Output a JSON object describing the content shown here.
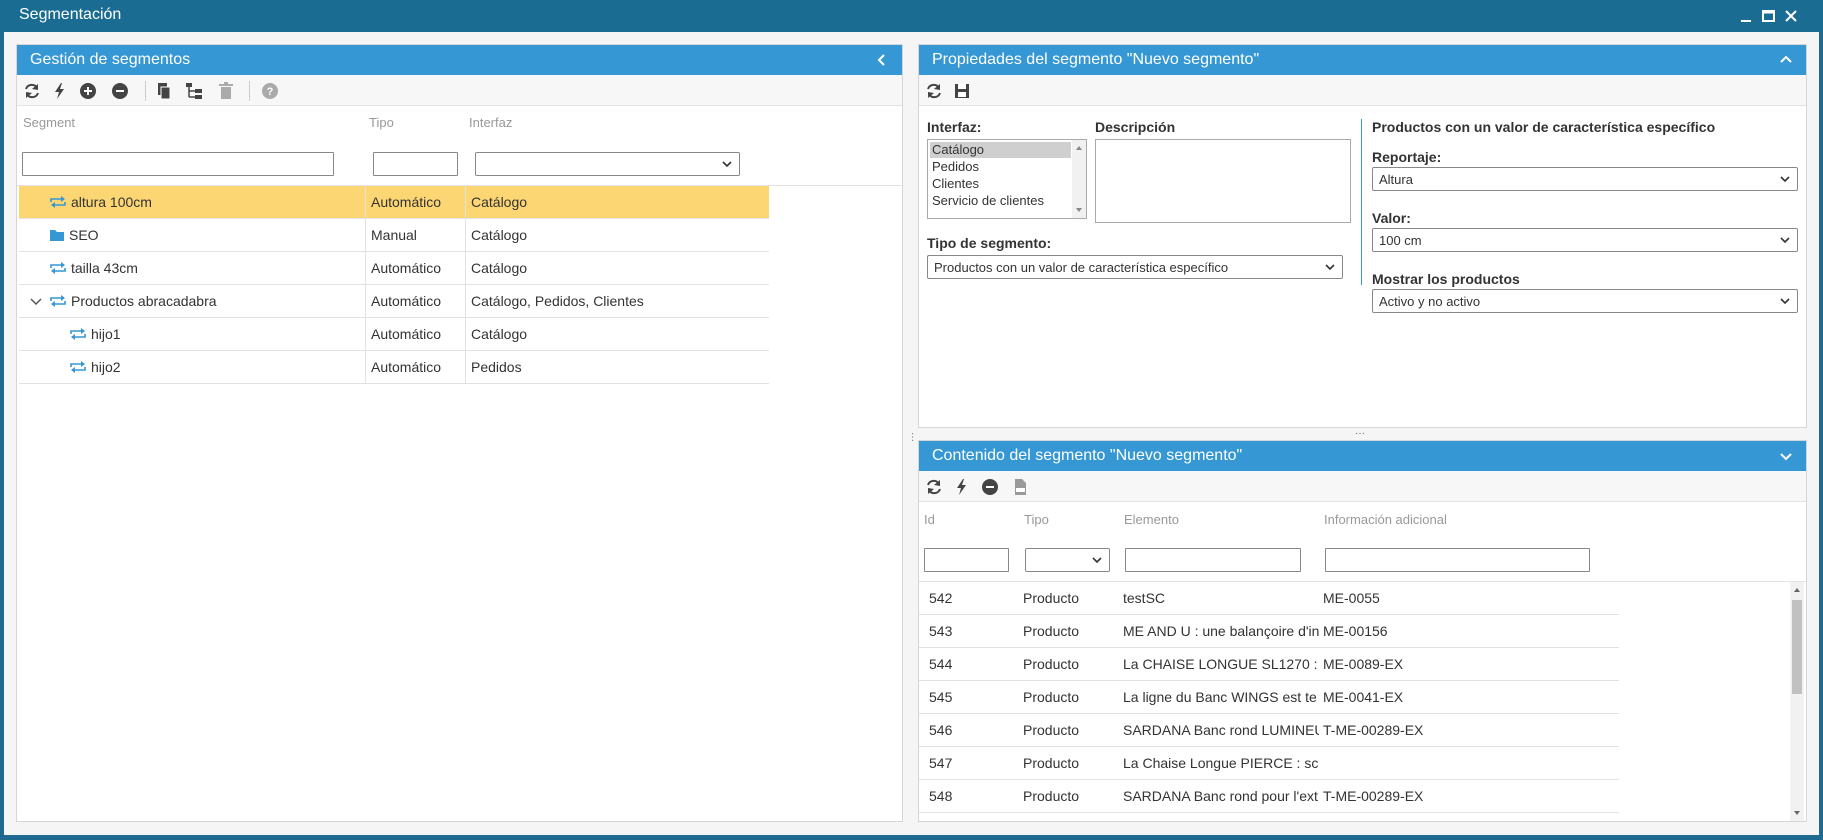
{
  "window": {
    "title": "Segmentación"
  },
  "left_panel": {
    "title": "Gestión de segmentos",
    "columns": {
      "segment": "Segment",
      "tipo": "Tipo",
      "interfaz": "Interfaz"
    },
    "rows": [
      {
        "name": "altura 100cm",
        "icon": "sync-icon",
        "tipo": "Automático",
        "interfaz": "Catálogo",
        "selected": true,
        "level": 0
      },
      {
        "name": "SEO",
        "icon": "folder-icon",
        "tipo": "Manual",
        "interfaz": "Catálogo",
        "selected": false,
        "level": 0
      },
      {
        "name": "tailla 43cm",
        "icon": "sync-icon",
        "tipo": "Automático",
        "interfaz": "Catálogo",
        "selected": false,
        "level": 0
      },
      {
        "name": "Productos abracadabra",
        "icon": "sync-icon",
        "tipo": "Automático",
        "interfaz": "Catálogo, Pedidos, Clientes",
        "selected": false,
        "level": 0,
        "expanded": true
      },
      {
        "name": "hijo1",
        "icon": "sync-icon",
        "tipo": "Automático",
        "interfaz": "Catálogo",
        "selected": false,
        "level": 1
      },
      {
        "name": "hijo2",
        "icon": "sync-icon",
        "tipo": "Automático",
        "interfaz": "Pedidos",
        "selected": false,
        "level": 1
      }
    ]
  },
  "props_panel": {
    "title": "Propiedades del segmento \"Nuevo segmento\"",
    "interfaz_label": "Interfaz:",
    "interfaz_options": [
      "Catálogo",
      "Pedidos",
      "Clientes",
      "Servicio de clientes"
    ],
    "interfaz_selected": "Catálogo",
    "descripcion_label": "Descripción",
    "tipo_segmento_label": "Tipo de segmento:",
    "tipo_segmento_value": "Productos con un valor de característica específico",
    "right_title": "Productos con un valor de característica específico",
    "reportaje_label": "Reportaje:",
    "reportaje_value": "Altura",
    "valor_label": "Valor:",
    "valor_value": "100 cm",
    "mostrar_label": "Mostrar los productos",
    "mostrar_value": "Activo y no activo"
  },
  "content_panel": {
    "title": "Contenido del segmento \"Nuevo segmento\"",
    "columns": {
      "id": "Id",
      "tipo": "Tipo",
      "elemento": "Elemento",
      "info": "Información adicional"
    },
    "rows": [
      {
        "id": "542",
        "tipo": "Producto",
        "elemento": "testSC",
        "info": "ME-0055"
      },
      {
        "id": "543",
        "tipo": "Producto",
        "elemento": "ME AND U : une balançoire d'in",
        "info": "ME-00156"
      },
      {
        "id": "544",
        "tipo": "Producto",
        "elemento": "La CHAISE LONGUE SL1270 :",
        "info": "ME-0089-EX"
      },
      {
        "id": "545",
        "tipo": "Producto",
        "elemento": "La ligne du Banc WINGS est te",
        "info": "ME-0041-EX"
      },
      {
        "id": "546",
        "tipo": "Producto",
        "elemento": "SARDANA Banc rond LUMINEU",
        "info": "T-ME-00289-EX"
      },
      {
        "id": "547",
        "tipo": "Producto",
        "elemento": "La Chaise Longue PIERCE : sc",
        "info": ""
      },
      {
        "id": "548",
        "tipo": "Producto",
        "elemento": "SARDANA Banc rond pour l'ext",
        "info": "T-ME-00289-EX"
      }
    ]
  },
  "colors": {
    "header": "#3597d3",
    "titlebar": "#1a6c93",
    "selected_row": "#fdd674",
    "icon_blue": "#3597d3"
  }
}
